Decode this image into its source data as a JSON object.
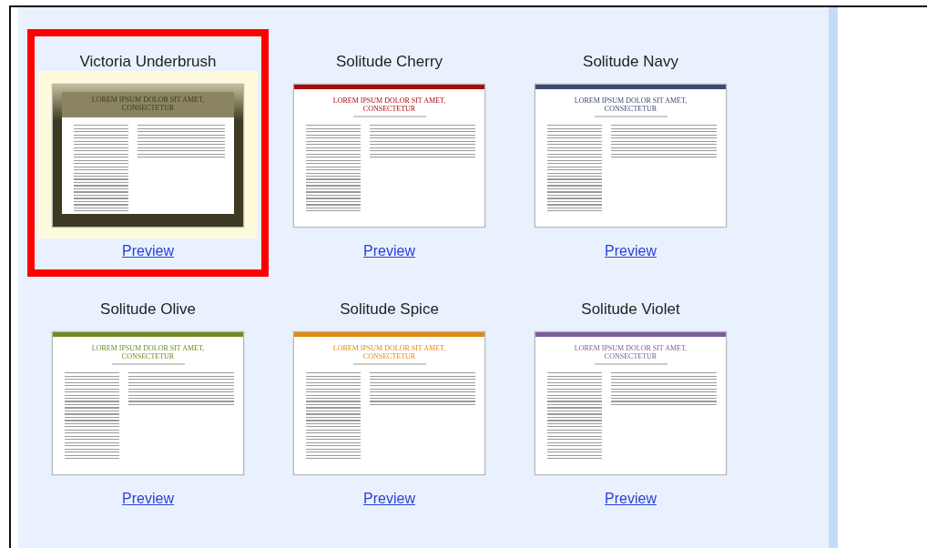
{
  "templates": [
    {
      "name": "Victoria Underbrush",
      "kind": "framed",
      "color": "#8a8462",
      "heading_lines": [
        "LOREM IPSUM DOLOR SIT AMET,",
        "CONSECTETUR"
      ],
      "link": "Preview",
      "selected": true
    },
    {
      "name": "Solitude Cherry",
      "kind": "accent",
      "color": "#a80c0c",
      "heading_lines": [
        "LOREM IPSUM DOLOR SIT AMET,",
        "CONSECTETUR"
      ],
      "link": "Preview",
      "selected": false
    },
    {
      "name": "Solitude Navy",
      "kind": "accent",
      "color": "#3c4a6e",
      "heading_lines": [
        "LOREM IPSUM DOLOR SIT AMET,",
        "CONSECTETUR"
      ],
      "link": "Preview",
      "selected": false
    },
    {
      "name": "Solitude Olive",
      "kind": "accent",
      "color": "#6e8c24",
      "heading_lines": [
        "LOREM IPSUM DOLOR SIT AMET,",
        "CONSECTETUR"
      ],
      "link": "Preview",
      "selected": false
    },
    {
      "name": "Solitude Spice",
      "kind": "accent",
      "color": "#e08a10",
      "heading_lines": [
        "LOREM IPSUM DOLOR SIT AMET,",
        "CONSECTETUR"
      ],
      "link": "Preview",
      "selected": false
    },
    {
      "name": "Solitude Violet",
      "kind": "accent",
      "color": "#7a5e9c",
      "heading_lines": [
        "LOREM IPSUM DOLOR SIT AMET,",
        "CONSECTETUR"
      ],
      "link": "Preview",
      "selected": false
    }
  ]
}
